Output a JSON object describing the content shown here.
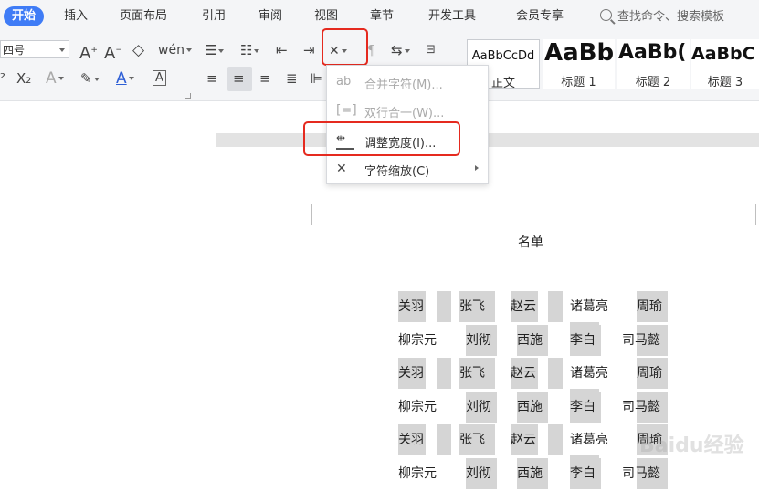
{
  "menu": {
    "tabs": [
      "开始",
      "插入",
      "页面布局",
      "引用",
      "审阅",
      "视图",
      "章节",
      "开发工具",
      "会员专享"
    ],
    "search_placeholder": "查找命令、搜索模板"
  },
  "ribbon": {
    "font_size": "四号",
    "styles": [
      {
        "sample": "AaBbCcDd",
        "name": "正文"
      },
      {
        "sample": "AaBb",
        "name": "标题 1"
      },
      {
        "sample": "AaBb(",
        "name": "标题 2"
      },
      {
        "sample": "AaBbC",
        "name": "标题 3"
      }
    ]
  },
  "dropdown": {
    "items": [
      {
        "label": "合并字符(M)...",
        "enabled": false
      },
      {
        "label": "双行合一(W)...",
        "enabled": false
      },
      {
        "label": "调整宽度(I)...",
        "enabled": true
      },
      {
        "label": "字符缩放(C)",
        "enabled": true
      }
    ]
  },
  "document": {
    "title": "名单",
    "rows": [
      [
        "关羽",
        "张飞",
        "赵云",
        "诸葛亮",
        "周瑜"
      ],
      [
        "柳宗元",
        "刘彻",
        "西施",
        "李白",
        "司马懿"
      ],
      [
        "关羽",
        "张飞",
        "赵云",
        "诸葛亮",
        "周瑜"
      ],
      [
        "柳宗元",
        "刘彻",
        "西施",
        "李白",
        "司马懿"
      ],
      [
        "关羽",
        "张飞",
        "赵云",
        "诸葛亮",
        "周瑜"
      ],
      [
        "柳宗元",
        "刘彻",
        "西施",
        "李白",
        "司马懿"
      ]
    ]
  },
  "watermark": "Baidu经验",
  "colors": {
    "accent": "#3f7cf6",
    "highlight_red": "#e52a1f"
  }
}
